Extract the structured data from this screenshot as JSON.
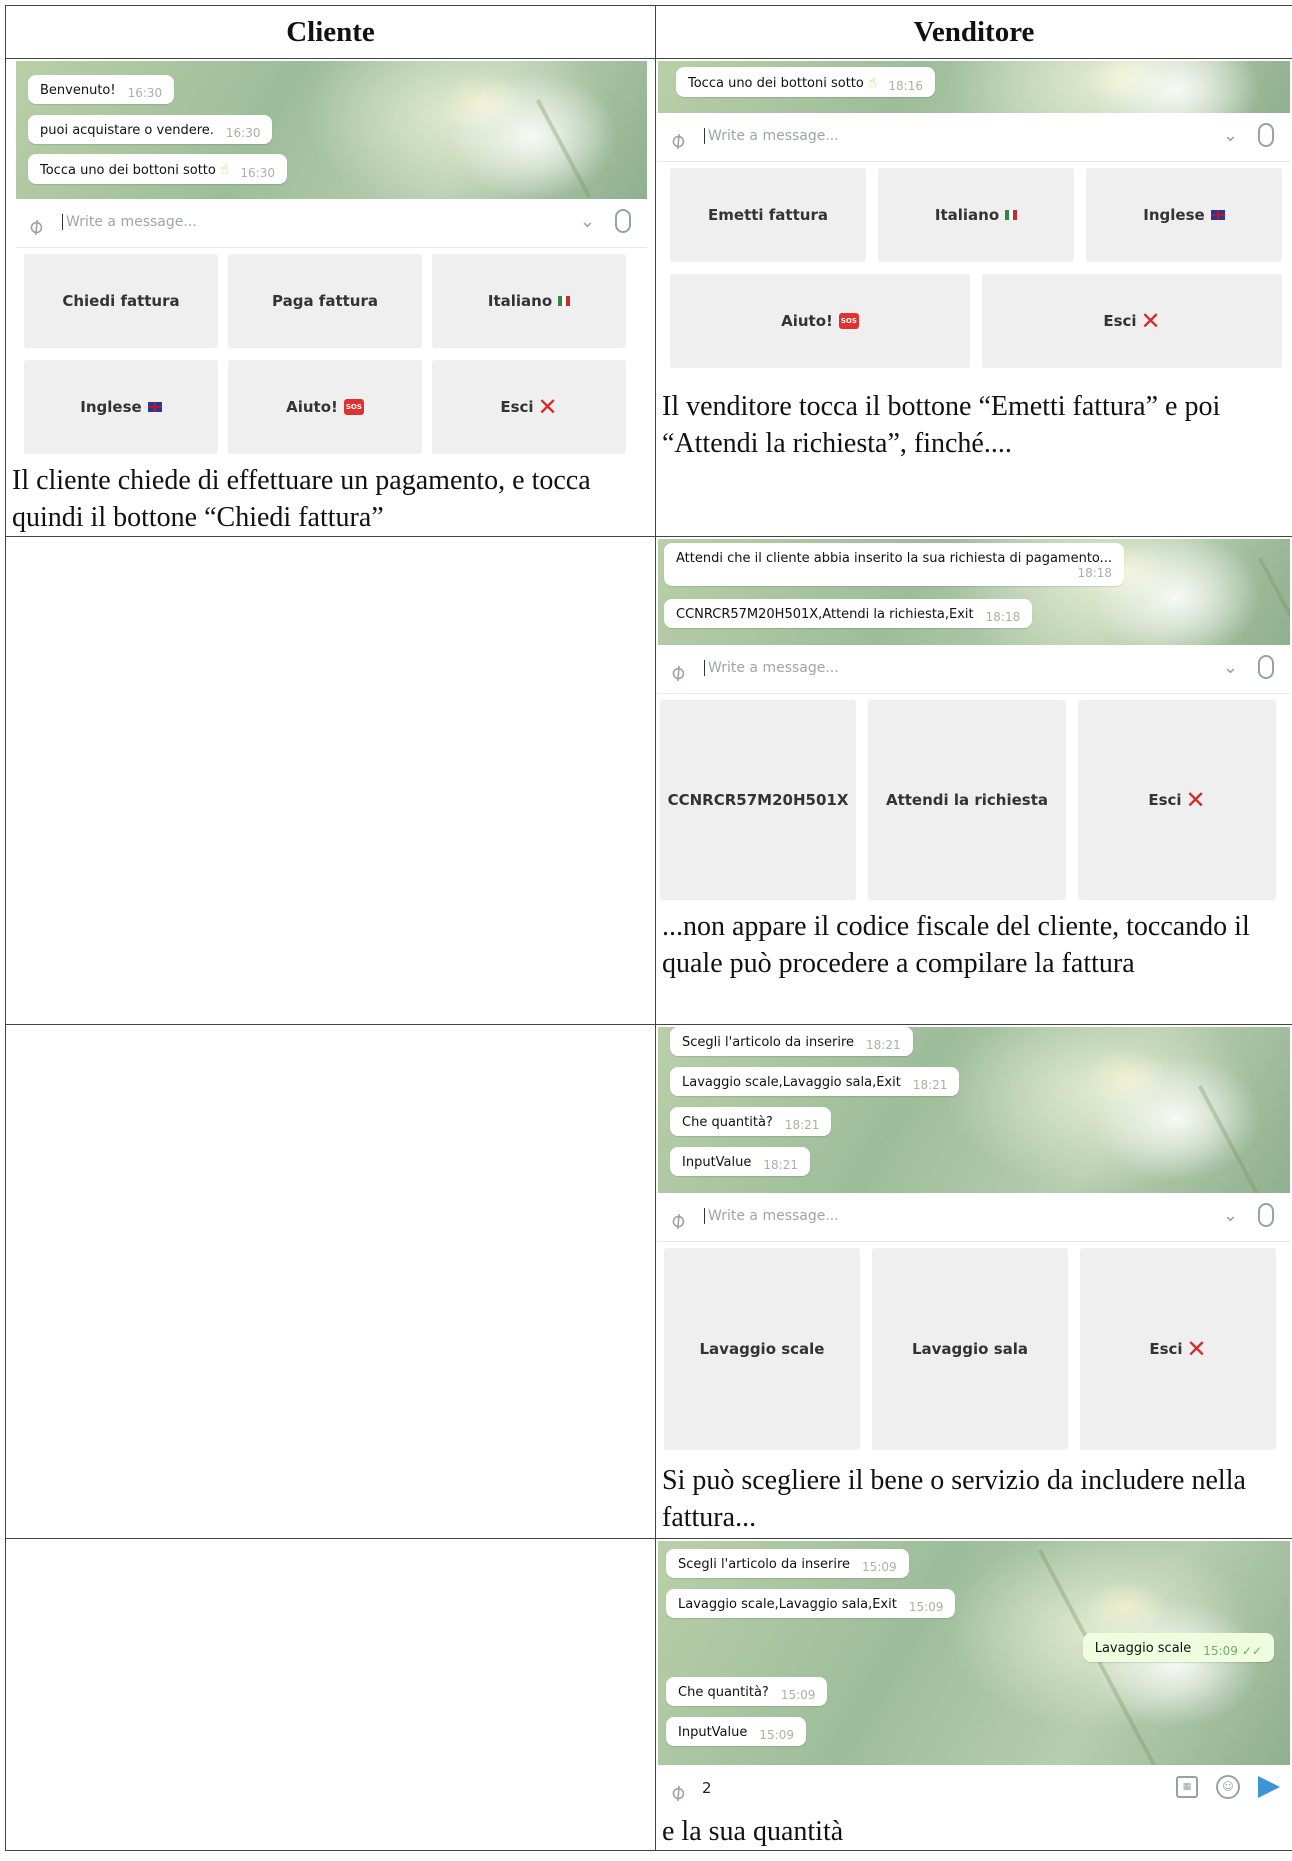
{
  "header": {
    "left": "Cliente",
    "right": "Venditore"
  },
  "input_placeholder": "Write a message...",
  "row1": {
    "left": {
      "bubbles": [
        {
          "text": "Benvenuto!",
          "time": "16:30"
        },
        {
          "text": "puoi acquistare o vendere.",
          "time": "16:30"
        },
        {
          "text": "Tocca uno dei bottoni sotto",
          "time": "16:30"
        }
      ],
      "keys": [
        "Chiedi fattura",
        "Paga fattura",
        "Italiano",
        "Inglese",
        "Aiuto!",
        "Esci"
      ],
      "caption": "Il cliente chiede di effettuare un pagamento, e tocca quindi il bottone “Chiedi fattura”"
    },
    "right": {
      "bubbles": [
        {
          "text": "Tocca uno dei bottoni sotto",
          "time": "18:16"
        }
      ],
      "keys": [
        "Emetti fattura",
        "Italiano",
        "Inglese",
        "Aiuto!",
        "Esci"
      ],
      "caption": "Il venditore  tocca il bottone “Emetti fattura” e poi “Attendi la richiesta”, finché...."
    }
  },
  "row2": {
    "right": {
      "bubbles": [
        {
          "text": "Attendi che il cliente abbia inserito la sua richiesta di pagamento...",
          "time": "18:18"
        },
        {
          "text": "CCNRCR57M20H501X,Attendi la richiesta,Exit",
          "time": "18:18"
        }
      ],
      "keys": [
        "CCNRCR57M20H501X",
        "Attendi la richiesta",
        "Esci"
      ],
      "caption": "...non appare il codice fiscale del cliente, toccando il quale può procedere a compilare la fattura"
    }
  },
  "row3": {
    "right": {
      "bubbles": [
        {
          "text": "Scegli l'articolo da inserire",
          "time": "18:21"
        },
        {
          "text": "Lavaggio scale,Lavaggio sala,Exit",
          "time": "18:21"
        },
        {
          "text": "Che quantità?",
          "time": "18:21"
        },
        {
          "text": "InputValue",
          "time": "18:21"
        }
      ],
      "keys": [
        "Lavaggio scale",
        "Lavaggio sala",
        "Esci"
      ],
      "caption": "Si può scegliere il bene o servizio da includere nella fattura..."
    }
  },
  "row4": {
    "right": {
      "bubbles": [
        {
          "text": "Scegli l'articolo da inserire",
          "time": "15:09"
        },
        {
          "text": "Lavaggio scale,Lavaggio sala,Exit",
          "time": "15:09"
        },
        {
          "text": "Lavaggio scale",
          "time": "15:09"
        },
        {
          "text": "Che quantità?",
          "time": "15:09"
        },
        {
          "text": "InputValue",
          "time": "15:09"
        }
      ],
      "typed": "2",
      "caption": "e  la sua quantità"
    }
  }
}
